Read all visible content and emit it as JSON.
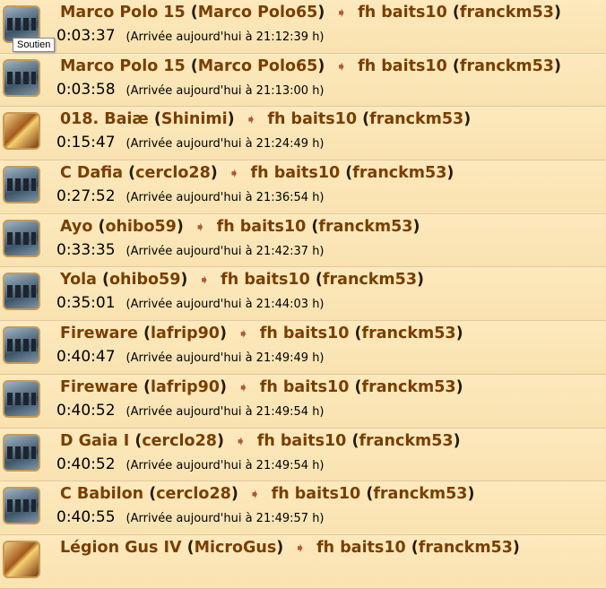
{
  "tooltip": "Soutien",
  "rows": [
    {
      "type": "support",
      "origin": "Marco Polo 15",
      "origin_player": "Marco Polo65",
      "target": "fh baits10",
      "target_player": "franckm53",
      "duration": "0:03:37",
      "arrival": "(Arrivée aujourd'hui à 21:12:39 h)"
    },
    {
      "type": "support",
      "origin": "Marco Polo 15",
      "origin_player": "Marco Polo65",
      "target": "fh baits10",
      "target_player": "franckm53",
      "duration": "0:03:58",
      "arrival": "(Arrivée aujourd'hui à 21:13:00 h)"
    },
    {
      "type": "attack",
      "origin": "018. Baiæ",
      "origin_player": "Shinimi",
      "target": "fh baits10",
      "target_player": "franckm53",
      "duration": "0:15:47",
      "arrival": "(Arrivée aujourd'hui à 21:24:49 h)"
    },
    {
      "type": "support",
      "origin": "C Dafia",
      "origin_player": "cerclo28",
      "target": "fh baits10",
      "target_player": "franckm53",
      "duration": "0:27:52",
      "arrival": "(Arrivée aujourd'hui à 21:36:54 h)"
    },
    {
      "type": "support",
      "origin": "Ayo",
      "origin_player": "ohibo59",
      "target": "fh baits10",
      "target_player": "franckm53",
      "duration": "0:33:35",
      "arrival": "(Arrivée aujourd'hui à 21:42:37 h)"
    },
    {
      "type": "support",
      "origin": "Yola",
      "origin_player": "ohibo59",
      "target": "fh baits10",
      "target_player": "franckm53",
      "duration": "0:35:01",
      "arrival": "(Arrivée aujourd'hui à 21:44:03 h)"
    },
    {
      "type": "support",
      "origin": "Fireware",
      "origin_player": "lafrip90",
      "target": "fh baits10",
      "target_player": "franckm53",
      "duration": "0:40:47",
      "arrival": "(Arrivée aujourd'hui à 21:49:49 h)"
    },
    {
      "type": "support",
      "origin": "Fireware",
      "origin_player": "lafrip90",
      "target": "fh baits10",
      "target_player": "franckm53",
      "duration": "0:40:52",
      "arrival": "(Arrivée aujourd'hui à 21:49:54 h)"
    },
    {
      "type": "support",
      "origin": "D Gaia I",
      "origin_player": "cerclo28",
      "target": "fh baits10",
      "target_player": "franckm53",
      "duration": "0:40:52",
      "arrival": "(Arrivée aujourd'hui à 21:49:54 h)"
    },
    {
      "type": "support",
      "origin": "C Babilon",
      "origin_player": "cerclo28",
      "target": "fh baits10",
      "target_player": "franckm53",
      "duration": "0:40:55",
      "arrival": "(Arrivée aujourd'hui à 21:49:57 h)"
    },
    {
      "type": "attack",
      "origin": "Légion Gus IV",
      "origin_player": "MicroGus",
      "target": "fh baits10",
      "target_player": "franckm53",
      "duration": "",
      "arrival": ""
    }
  ]
}
